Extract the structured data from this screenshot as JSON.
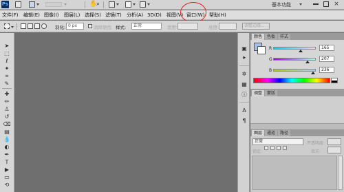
{
  "app": {
    "logo": "Ps"
  },
  "appbar": {
    "workspace": "基本功能",
    "close": "×"
  },
  "menu": [
    {
      "id": "file",
      "label": "文件(F)"
    },
    {
      "id": "edit",
      "label": "编辑(E)"
    },
    {
      "id": "image",
      "label": "图像(I)"
    },
    {
      "id": "layer",
      "label": "图层(L)"
    },
    {
      "id": "select",
      "label": "选择(S)"
    },
    {
      "id": "filter",
      "label": "滤镜(T)"
    },
    {
      "id": "analysis",
      "label": "分析(A)"
    },
    {
      "id": "3d",
      "label": "3D(D)"
    },
    {
      "id": "view",
      "label": "视图(V)"
    },
    {
      "id": "window",
      "label": "窗口(W)"
    },
    {
      "id": "help",
      "label": "帮助(H)"
    }
  ],
  "options": {
    "feather_label": "羽化:",
    "feather_value": "0 px",
    "antialias_label": "消除锯齿",
    "style_label": "样式:",
    "style_value": "正常",
    "width_label": "宽度:",
    "height_label": "高度:",
    "refine_label": "调整边缘..."
  },
  "color_panel": {
    "tabs": [
      "颜色",
      "色板",
      "样式"
    ],
    "channels": [
      {
        "name": "R",
        "value": "165",
        "thumb": 0.65
      },
      {
        "name": "G",
        "value": "207",
        "thumb": 0.81
      },
      {
        "name": "B",
        "value": "236",
        "thumb": 0.93
      }
    ]
  },
  "adjust_panel": {
    "tabs": [
      "调整",
      "蒙版"
    ]
  },
  "layers_panel": {
    "tabs": [
      "图层",
      "通道",
      "路径"
    ],
    "blend_mode": "正常",
    "opacity_label": "不透明度:",
    "lock_label": "锁定:",
    "fill_label": "填充:"
  }
}
